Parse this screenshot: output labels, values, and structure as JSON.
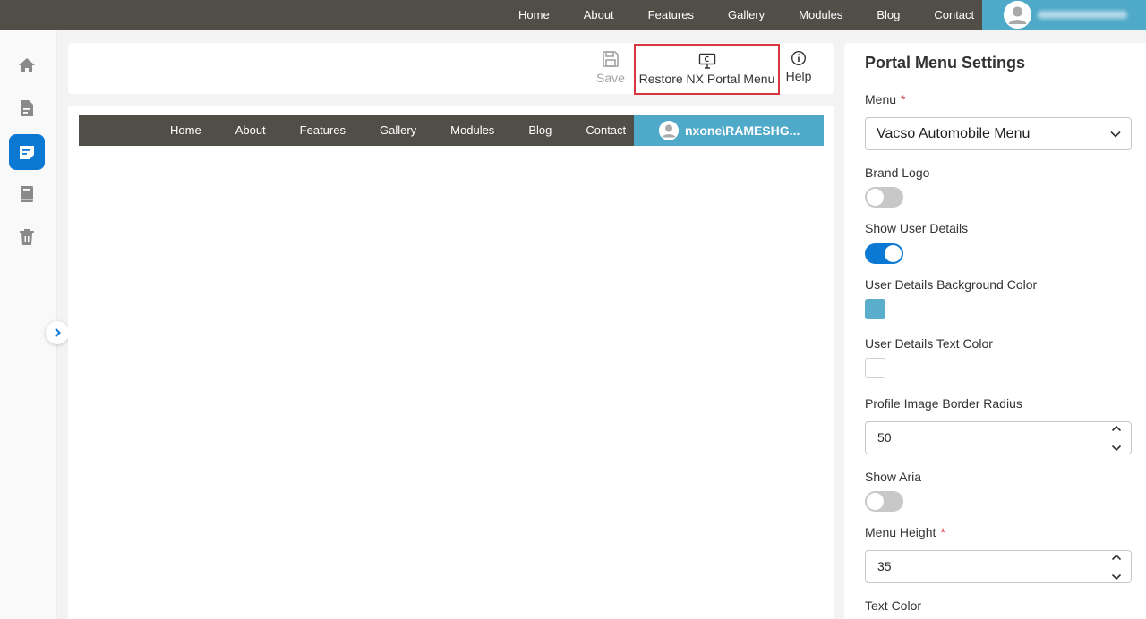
{
  "top_nav": {
    "links": [
      "Home",
      "About",
      "Features",
      "Gallery",
      "Modules",
      "Blog",
      "Contact"
    ],
    "user_bg": "#4fa9c9"
  },
  "rail": {
    "items": [
      {
        "icon": "home-icon",
        "active": false
      },
      {
        "icon": "document-icon",
        "active": false
      },
      {
        "icon": "menu-editor-icon",
        "active": true
      },
      {
        "icon": "book-icon",
        "active": false
      },
      {
        "icon": "trash-icon",
        "active": false
      }
    ],
    "active_color": "#0b78d4"
  },
  "toolbar": {
    "save_label": "Save",
    "restore_label": "Restore NX Portal Menu",
    "help_label": "Help"
  },
  "preview": {
    "links": [
      "Home",
      "About",
      "Features",
      "Gallery",
      "Modules",
      "Blog",
      "Contact"
    ],
    "user_name": "nxone\\RAMESHG..."
  },
  "panel": {
    "title": "Portal Menu Settings",
    "menu_label": "Menu",
    "menu_value": "Vacso Automobile Menu",
    "brand_logo_label": "Brand Logo",
    "brand_logo_on": false,
    "show_user_details_label": "Show User Details",
    "show_user_details_on": true,
    "user_bg_color_label": "User Details Background Color",
    "user_bg_color": "#5aaecb",
    "user_text_color_label": "User Details Text Color",
    "user_text_color": "#ffffff",
    "profile_radius_label": "Profile Image Border Radius",
    "profile_radius_value": "50",
    "show_aria_label": "Show Aria",
    "show_aria_on": false,
    "menu_height_label": "Menu Height",
    "menu_height_value": "35",
    "text_color_label": "Text Color",
    "required_mark": "*"
  }
}
